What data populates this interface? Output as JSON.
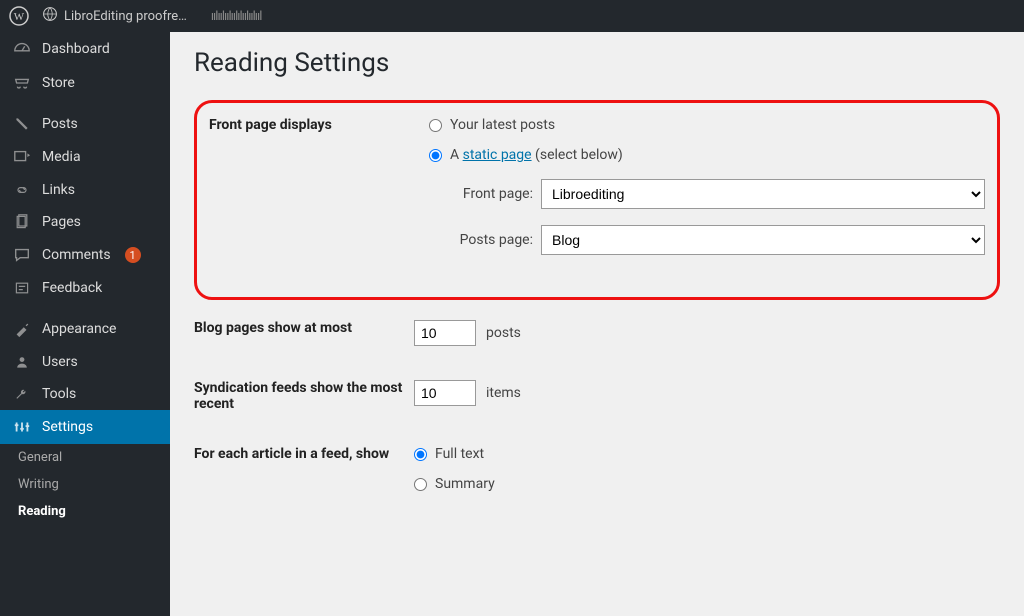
{
  "topbar": {
    "site_title": "LibroEditing proofre…"
  },
  "sidebar": {
    "dashboard": "Dashboard",
    "store": "Store",
    "posts": "Posts",
    "media": "Media",
    "links": "Links",
    "pages": "Pages",
    "comments": "Comments",
    "comments_count": "1",
    "feedback": "Feedback",
    "appearance": "Appearance",
    "users": "Users",
    "tools": "Tools",
    "settings": "Settings",
    "sub": {
      "general": "General",
      "writing": "Writing",
      "reading": "Reading"
    }
  },
  "page": {
    "title": "Reading Settings",
    "front_page_displays": {
      "label": "Front page displays",
      "option_latest": "Your latest posts",
      "option_static_prefix": "A ",
      "option_static_link": "static page",
      "option_static_suffix": " (select below)",
      "front_page_label": "Front page:",
      "front_page_value": "Libroediting",
      "posts_page_label": "Posts page:",
      "posts_page_value": "Blog"
    },
    "blog_pages": {
      "label": "Blog pages show at most",
      "value": "10",
      "suffix": "posts"
    },
    "syndication": {
      "label": "Syndication feeds show the most recent",
      "value": "10",
      "suffix": "items"
    },
    "article_feed": {
      "label": "For each article in a feed, show",
      "option_full": "Full text",
      "option_summary": "Summary"
    }
  }
}
